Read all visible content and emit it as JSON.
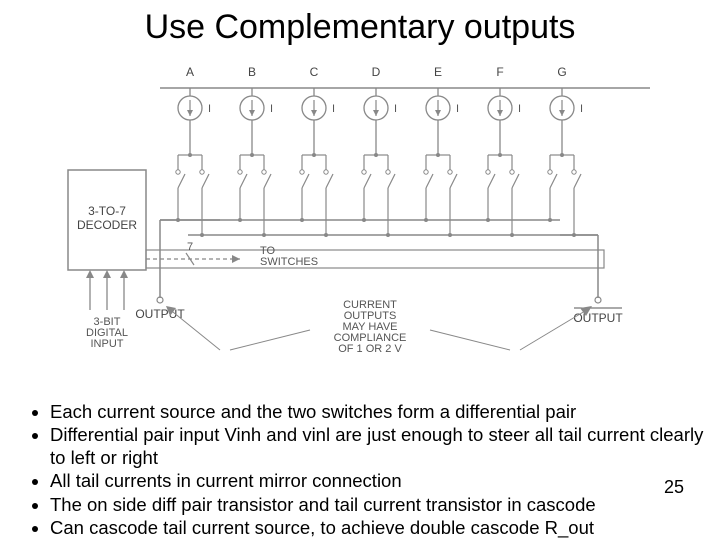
{
  "title": "Use Complementary outputs",
  "diagram": {
    "top_labels": [
      "A",
      "B",
      "C",
      "D",
      "E",
      "F",
      "G"
    ],
    "current_label": "I",
    "decoder_block": "3-TO-7\nDECODER",
    "to_switches": "TO\nSWITCHES",
    "slash_label": "7",
    "three_bit_input": "3-BIT\nDIGITAL\nINPUT",
    "output_label": "OUTPUT",
    "compliance_text": "CURRENT\nOUTPUTS\nMAY HAVE\nCOMPLIANCE\nOF 1 OR 2 V"
  },
  "bullets": [
    "Each current source and the two switches form a differential pair",
    "Differential pair input Vinh and vinl are just enough to steer all tail current clearly to left or right",
    "All tail currents in current mirror connection",
    "The on side diff pair transistor and tail current transistor in cascode",
    "Can cascode tail current source, to achieve double cascode R_out"
  ],
  "page_number": "25"
}
